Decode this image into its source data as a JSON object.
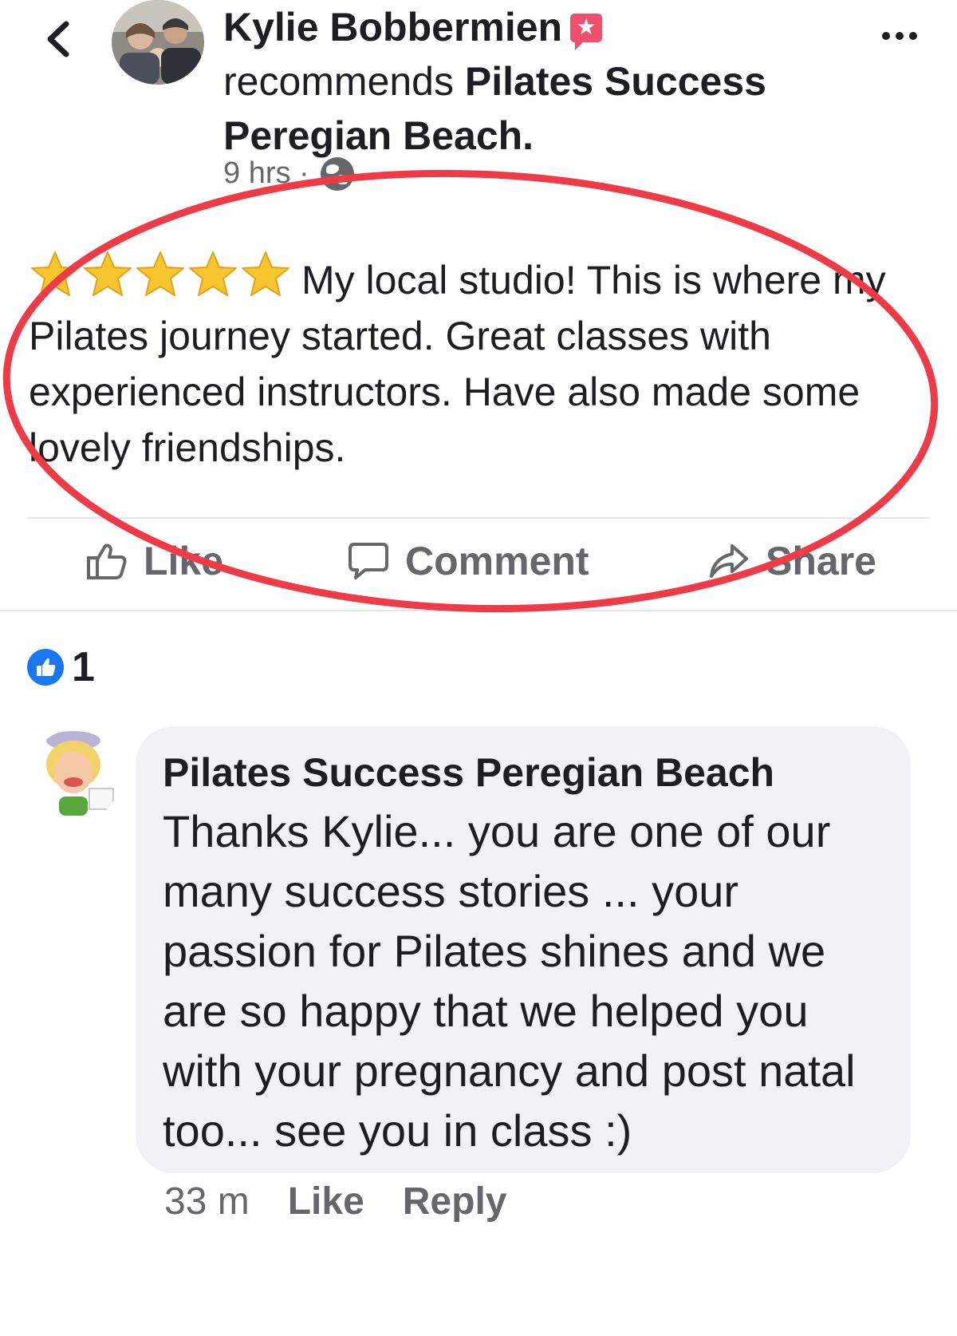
{
  "header": {
    "back_icon": "chevron-left-icon",
    "author": "Kylie Bobbermien",
    "recommends_text": "recommends",
    "page_name": "Pilates Success Peregian Beach",
    "period": ".",
    "timestamp": "9 hrs ·",
    "privacy_icon": "globe-icon",
    "more_icon": "more-options-icon"
  },
  "review": {
    "rating": 5,
    "text": "My local studio! This is where my Pilates journey started. Great classes with experienced instructors. Have also made some lovely friendships."
  },
  "actions": {
    "like": "Like",
    "comment": "Comment",
    "share": "Share"
  },
  "reactions": {
    "count": "1"
  },
  "comment": {
    "author": "Pilates Success Peregian Beach",
    "text": "Thanks Kylie... you are one of our many success stories ... your passion for Pilates shines and we are so happy that we helped you with your pregnancy and post natal too... see you in class :)",
    "time": "33 m",
    "like": "Like",
    "reply": "Reply"
  },
  "colors": {
    "annotation_ring": "#ee3b47",
    "accent_blue": "#1877f2",
    "star_gold": "#f7c62f",
    "recommend_badge": "#f0506e"
  }
}
